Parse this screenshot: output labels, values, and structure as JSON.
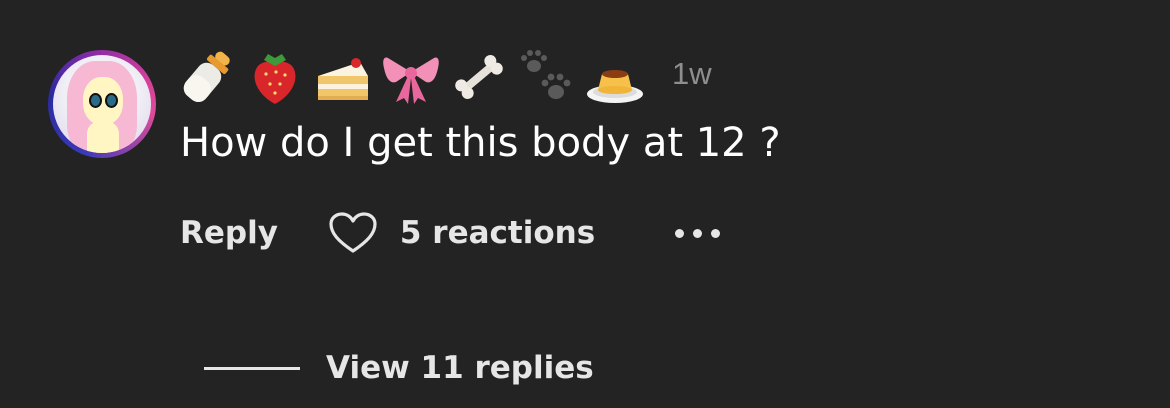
{
  "comment": {
    "author_emojis": [
      "🍼",
      "🍓",
      "🍰",
      "🎀",
      "🦴",
      "🐾",
      "🍮"
    ],
    "author_emoji_icons": [
      "baby-bottle-icon",
      "strawberry-icon",
      "cake-icon",
      "ribbon-icon",
      "bone-icon",
      "paw-prints-icon",
      "pudding-icon"
    ],
    "timestamp": "1w",
    "text": "How do I get this body at 12 ?"
  },
  "actions": {
    "reply_label": "Reply",
    "reactions_label": "5 reactions"
  },
  "replies": {
    "label": "View 11 replies"
  },
  "colors": {
    "background": "#232323",
    "text_primary": "#ffffff",
    "text_secondary": "#8e8e8e"
  }
}
